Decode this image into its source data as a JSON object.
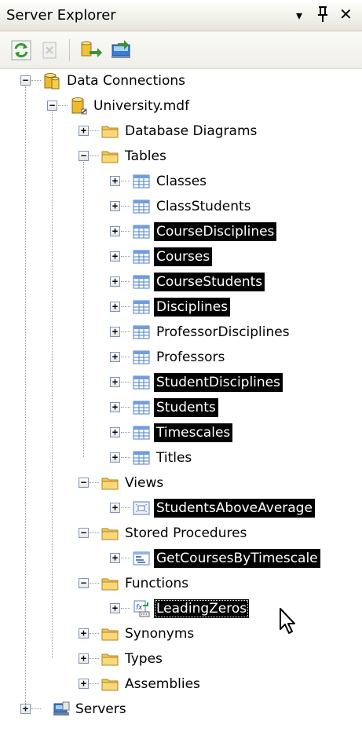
{
  "window": {
    "title": "Server Explorer",
    "controls": {
      "dropdown": "▾",
      "pin": "ᛌ",
      "close": "✕"
    }
  },
  "toolbar": {
    "buttons": [
      {
        "name": "refresh-button",
        "icon": "refresh-icon"
      },
      {
        "name": "stop-refresh-button",
        "icon": "stop-icon"
      },
      {
        "name": "connect-to-database-button",
        "icon": "connect-database-icon"
      },
      {
        "name": "connect-to-server-button",
        "icon": "connect-server-icon"
      }
    ]
  },
  "tree": {
    "data_connections": "Data Connections",
    "database": "University.mdf",
    "database_diagrams": "Database Diagrams",
    "tables": "Tables",
    "table_items": [
      "Classes",
      "ClassStudents",
      "CourseDisciplines",
      "Courses",
      "CourseStudents",
      "Disciplines",
      "ProfessorDisciplines",
      "Professors",
      "StudentDisciplines",
      "Students",
      "Timescales",
      "Titles"
    ],
    "views": "Views",
    "view_item": "StudentsAboveAverage",
    "stored_procedures": "Stored Procedures",
    "procedure_item": "GetCoursesByTimescale",
    "functions": "Functions",
    "function_item": "LeadingZeros",
    "synonyms": "Synonyms",
    "types": "Types",
    "assemblies": "Assemblies",
    "servers": "Servers"
  },
  "colors": {
    "selection": "#000000",
    "selection_text": "#ffffff",
    "folder": "#f3c55a",
    "table_grid": "#4c7fc8"
  }
}
